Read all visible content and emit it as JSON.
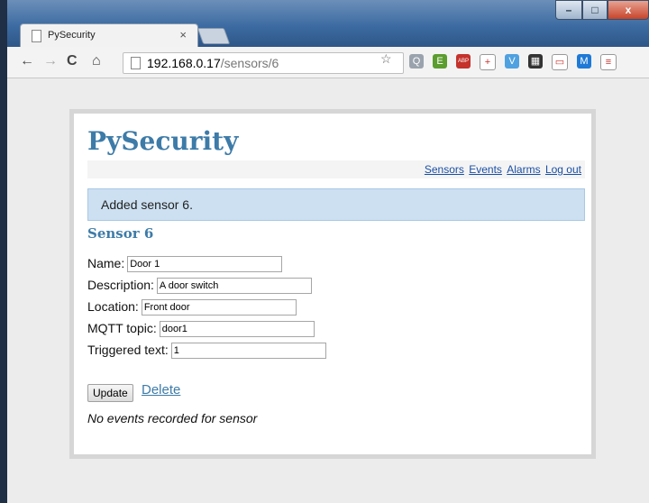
{
  "browser": {
    "tab_title": "PySecurity",
    "tab_close": "×",
    "url_host": "192.168.0.17",
    "url_path": "/sensors/6",
    "window_buttons": {
      "minimize": "–",
      "maximize": "□",
      "close": "x"
    },
    "nav": {
      "back": "←",
      "forward": "→",
      "reload": "C",
      "home": "⌂"
    },
    "star": "☆",
    "extensions": [
      {
        "name": "search-ext-icon",
        "color": "#9aa3ad",
        "glyph": "Q"
      },
      {
        "name": "evernote-ext-icon",
        "color": "#5b9d2e",
        "glyph": "E"
      },
      {
        "name": "adblock-plus-icon",
        "color": "#c4332c",
        "glyph": "ABP"
      },
      {
        "name": "first-aid-ext-icon",
        "color": "#ffffff",
        "glyph": "+"
      },
      {
        "name": "v-ext-icon",
        "color": "#4fa1e0",
        "glyph": "V"
      },
      {
        "name": "film-ext-icon",
        "color": "#333333",
        "glyph": "▦"
      },
      {
        "name": "cast-icon",
        "color": "#ffffff",
        "glyph": "▭"
      },
      {
        "name": "m-ext-icon",
        "color": "#1e7ad6",
        "glyph": "M"
      },
      {
        "name": "menu-icon",
        "color": "#ffffff",
        "glyph": "≡"
      }
    ]
  },
  "page": {
    "brand": "PySecurity",
    "nav_links": [
      "Sensors",
      "Events",
      "Alarms",
      "Log out"
    ],
    "flash_message": "Added sensor 6.",
    "heading": "Sensor 6",
    "fields": {
      "name": {
        "label": "Name:",
        "value": "Door 1"
      },
      "description": {
        "label": "Description:",
        "value": "A door switch"
      },
      "location": {
        "label": "Location:",
        "value": "Front door"
      },
      "mqtt_topic": {
        "label": "MQTT topic:",
        "value": "door1"
      },
      "triggered_text": {
        "label": "Triggered text:",
        "value": "1"
      }
    },
    "update_button": "Update",
    "delete_link": "Delete",
    "no_events": "No events recorded for sensor"
  },
  "colors": {
    "accent": "#3d7ba8",
    "flash_bg": "#cce0f2",
    "link": "#1a4fa5"
  }
}
